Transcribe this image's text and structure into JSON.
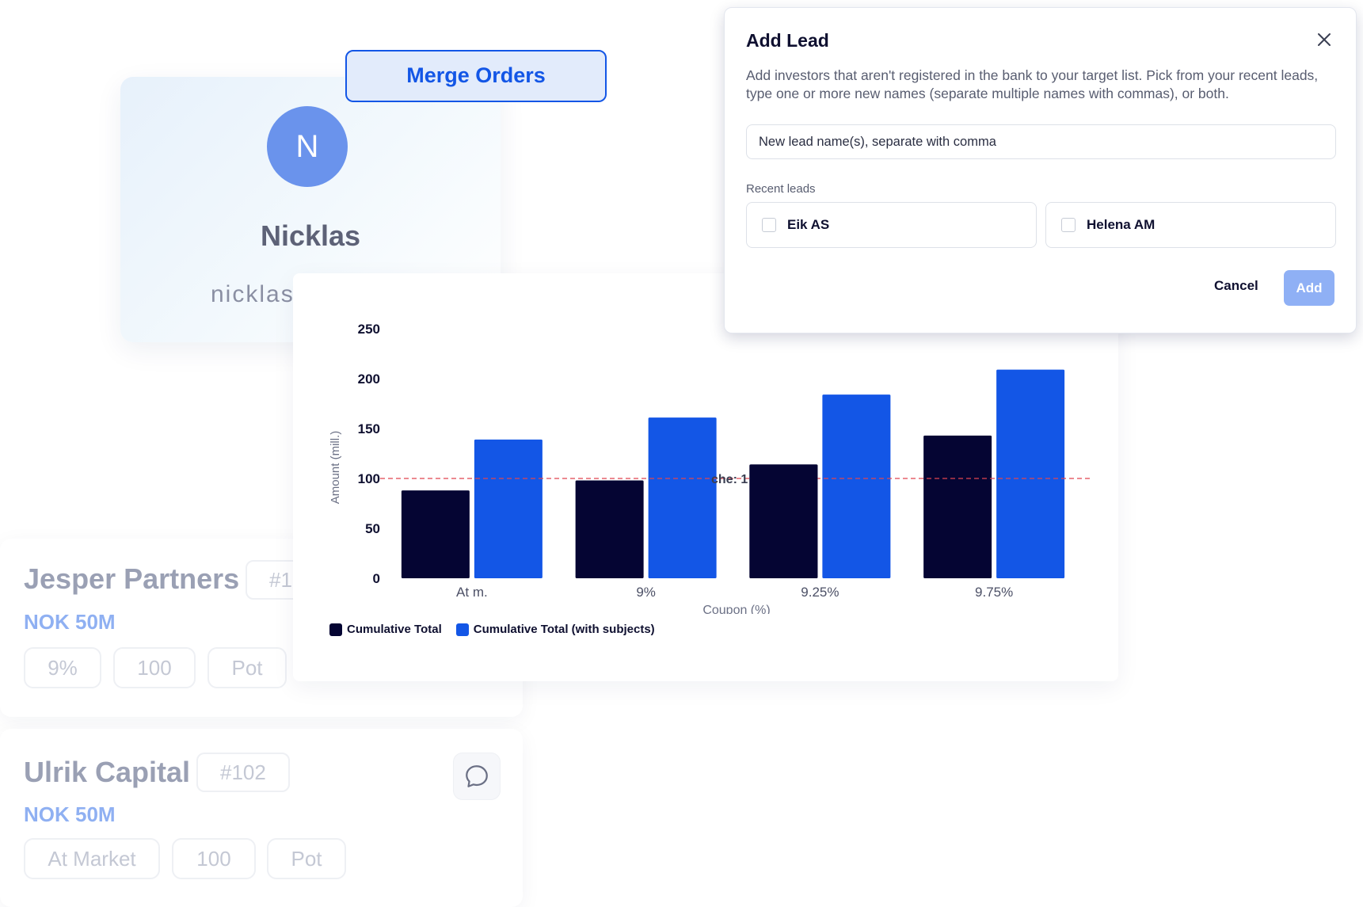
{
  "merge_button": {
    "label": "Merge Orders"
  },
  "profile": {
    "avatar_letter": "N",
    "name": "Nicklas",
    "username": "nicklas"
  },
  "orders": [
    {
      "name": "Jesper Partners",
      "id": "#1",
      "amount": "NOK 50M",
      "chips": [
        "9%",
        "100",
        "Pot"
      ]
    },
    {
      "name": "Ulrik Capital",
      "id": "#102",
      "amount": "NOK 50M",
      "chips": [
        "At Market",
        "100",
        "Pot"
      ],
      "comment_icon": "chat-bubble-icon"
    }
  ],
  "chart_data": {
    "type": "bar",
    "categories": [
      "At m.",
      "9%",
      "9.25%",
      "9.75%"
    ],
    "series": [
      {
        "name": "Cumulative Total",
        "values": [
          88,
          98,
          114,
          143
        ],
        "color": "#050533"
      },
      {
        "name": "Cumulative Total (with subjects)",
        "values": [
          139,
          161,
          184,
          209
        ],
        "color": "#1356e6"
      }
    ],
    "xlabel": "Coupon (%)",
    "ylabel": "Amount (mill.)",
    "ylim": [
      0,
      250
    ],
    "yticks": [
      0,
      50,
      100,
      150,
      200,
      250
    ],
    "reference_line": {
      "value": 100,
      "label": "che: 1",
      "color": "#e0454f"
    },
    "legend_position": "bottom-left"
  },
  "modal": {
    "title": "Add Lead",
    "description": "Add investors that aren't registered in the bank to your target list. Pick from your recent leads, type one or more new names (separate multiple names with commas), or both.",
    "input_placeholder": "New lead name(s), separate with comma",
    "recent_label": "Recent leads",
    "recent_leads": [
      "Eik AS",
      "Helena AM"
    ],
    "cancel_label": "Cancel",
    "add_label": "Add",
    "close_icon": "close-icon"
  }
}
